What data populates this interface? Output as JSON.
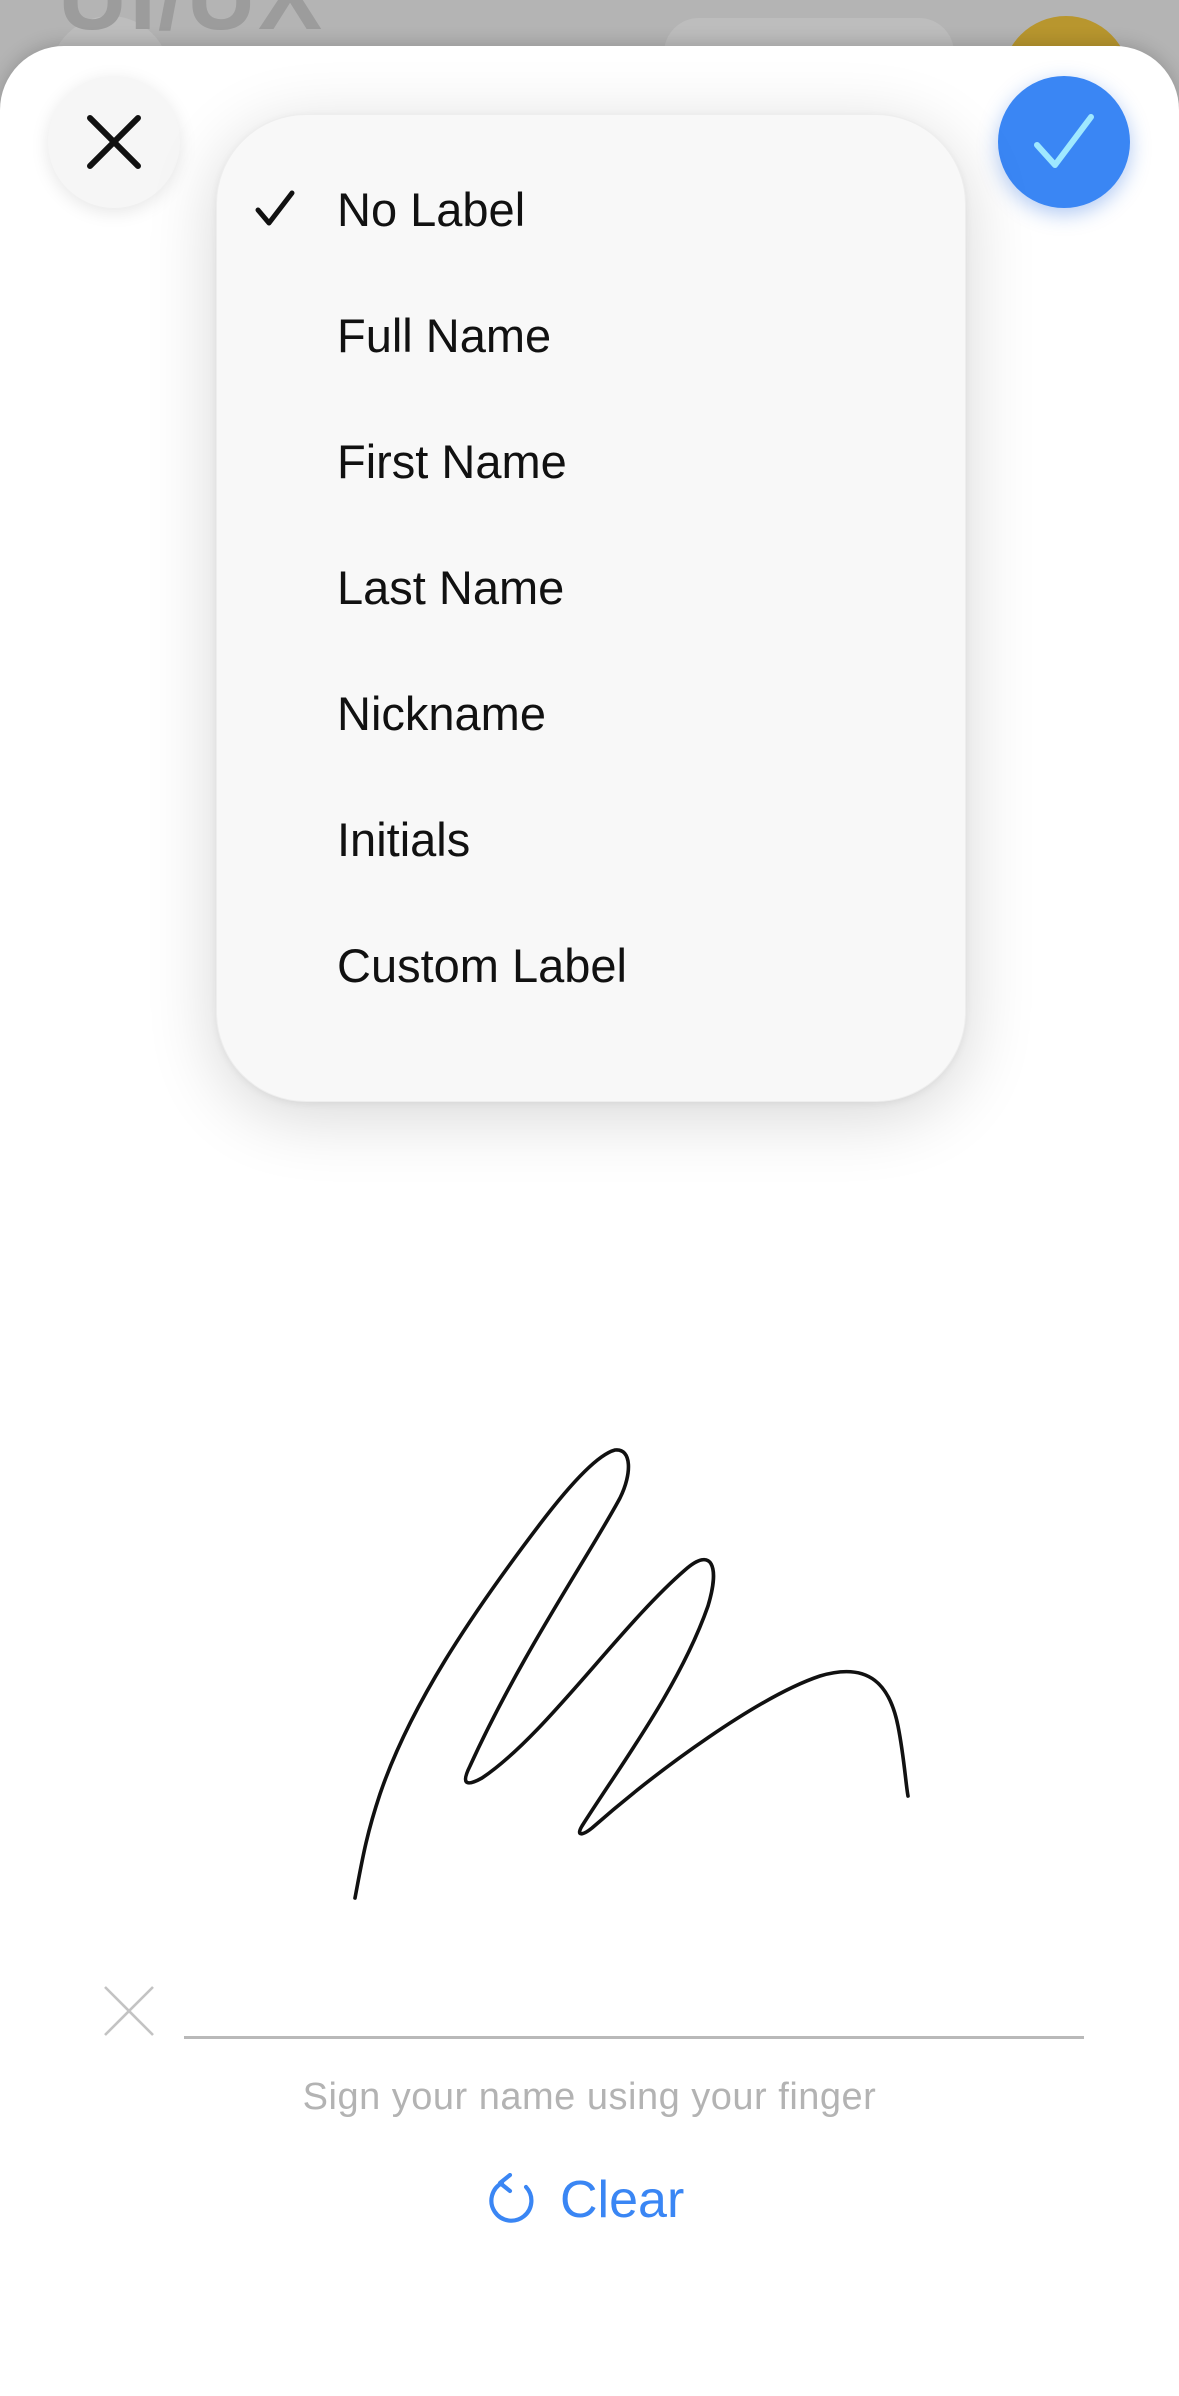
{
  "background": {
    "title_fragment": "UI/UX"
  },
  "header": {
    "close_icon": "close-icon",
    "confirm_icon": "checkmark-icon"
  },
  "menu": {
    "items": [
      {
        "label": "No Label",
        "selected": true
      },
      {
        "label": "Full Name",
        "selected": false
      },
      {
        "label": "First Name",
        "selected": false
      },
      {
        "label": "Last Name",
        "selected": false
      },
      {
        "label": "Nickname",
        "selected": false
      },
      {
        "label": "Initials",
        "selected": false
      },
      {
        "label": "Custom Label",
        "selected": false
      }
    ]
  },
  "signature": {
    "hint": "Sign your name using your finger",
    "clear_label": "Clear"
  },
  "colors": {
    "accent": "#3a86f4",
    "menu_bg": "#f8f8f8",
    "hint_text": "#b3b3b3"
  }
}
